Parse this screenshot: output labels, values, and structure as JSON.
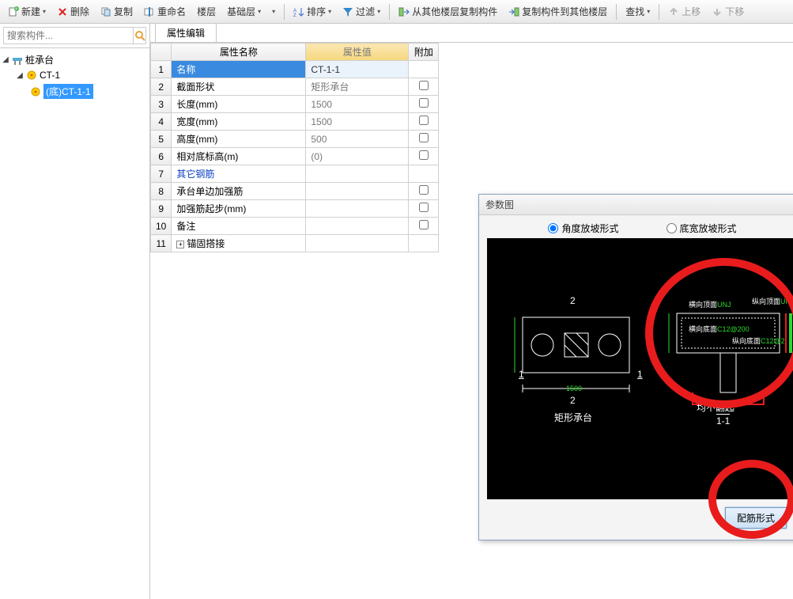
{
  "toolbar": {
    "new": "新建",
    "delete": "删除",
    "copy": "复制",
    "rename": "重命名",
    "floor_label": "楼层",
    "floor_value": "基础层",
    "sort": "排序",
    "filter": "过滤",
    "copy_from_other": "从其他楼层复制构件",
    "copy_to_other": "复制构件到其他楼层",
    "find": "查找",
    "move_up": "上移",
    "move_down": "下移"
  },
  "search": {
    "placeholder": "搜索构件..."
  },
  "tree": {
    "root": "桩承台",
    "child1": "CT-1",
    "child2": "(底)CT-1-1"
  },
  "tab": {
    "label": "属性编辑"
  },
  "grid": {
    "head_name": "属性名称",
    "head_value": "属性值",
    "head_add": "附加",
    "rows": [
      {
        "n": "1",
        "name": "名称",
        "value": "CT-1-1",
        "chk": false,
        "sel": true,
        "blue": false,
        "hasChk": false
      },
      {
        "n": "2",
        "name": "截面形状",
        "value": "矩形承台",
        "chk": false,
        "sel": false,
        "blue": false,
        "hasChk": true
      },
      {
        "n": "3",
        "name": "长度(mm)",
        "value": "1500",
        "chk": false,
        "sel": false,
        "blue": false,
        "hasChk": true
      },
      {
        "n": "4",
        "name": "宽度(mm)",
        "value": "1500",
        "chk": false,
        "sel": false,
        "blue": false,
        "hasChk": true
      },
      {
        "n": "5",
        "name": "高度(mm)",
        "value": "500",
        "chk": false,
        "sel": false,
        "blue": false,
        "hasChk": true
      },
      {
        "n": "6",
        "name": "相对底标高(m)",
        "value": "(0)",
        "chk": false,
        "sel": false,
        "blue": false,
        "hasChk": true
      },
      {
        "n": "7",
        "name": "其它钢筋",
        "value": "",
        "chk": false,
        "sel": false,
        "blue": true,
        "hasChk": false
      },
      {
        "n": "8",
        "name": "承台单边加强筋",
        "value": "",
        "chk": false,
        "sel": false,
        "blue": false,
        "hasChk": true
      },
      {
        "n": "9",
        "name": "加强筋起步(mm)",
        "value": "",
        "chk": false,
        "sel": false,
        "blue": false,
        "hasChk": true
      },
      {
        "n": "10",
        "name": "备注",
        "value": "",
        "chk": false,
        "sel": false,
        "blue": false,
        "hasChk": true
      },
      {
        "n": "11",
        "name": "锚固搭接",
        "value": "",
        "chk": false,
        "sel": false,
        "blue": false,
        "hasChk": false,
        "expand": true
      }
    ]
  },
  "dialog": {
    "title": "参数图",
    "opt1": "角度放坡形式",
    "opt2": "底宽放坡形式",
    "button": "配筋形式",
    "cad": {
      "shape_label": "矩形承台",
      "no_flip": "均不翻起",
      "section": "1-1",
      "dim1": "1",
      "dim2": "2",
      "dim_len": "1500",
      "lab_top_h": "横向顶面",
      "lab_top_v": "纵向顶面",
      "lab_bot_h": "横向底面C12@200",
      "lab_bot_v": "纵向底面C12@2",
      "unit": "UNJ"
    }
  }
}
